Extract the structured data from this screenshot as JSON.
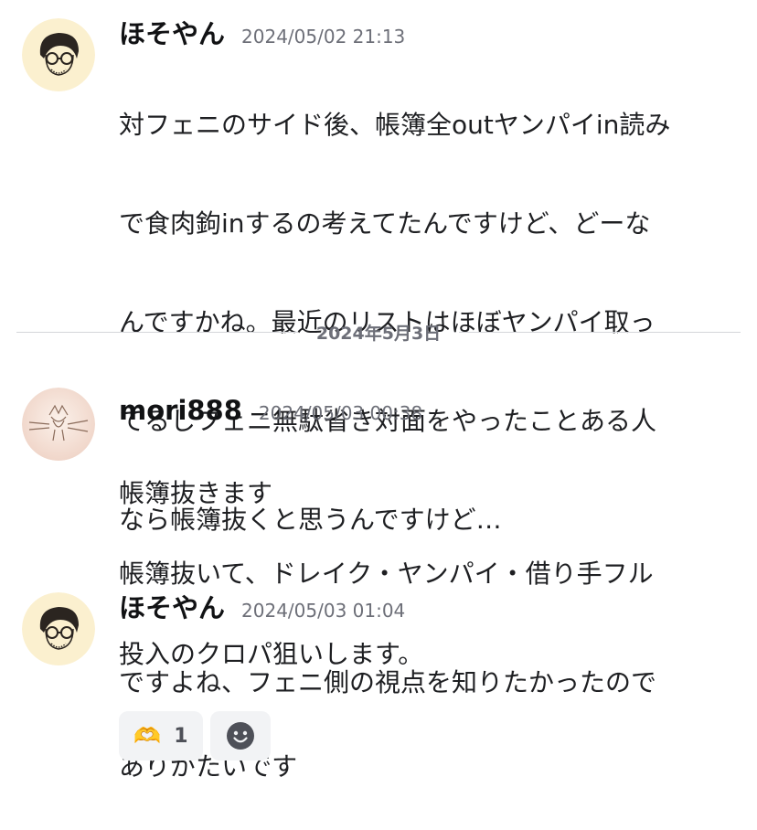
{
  "messages": [
    {
      "username": "ほそやん",
      "timestamp": "2024/05/02 21:13",
      "lines": [
        "対フェニのサイド後、帳簿全outヤンパイin読み",
        "で食肉鉤inするの考えてたんですけど、どーな",
        "んですかね。最近のリストはほぼヤンパイ取っ",
        "てるしフェニ無駄省き対面をやったことある人",
        "なら帳簿抜くと思うんですけど…"
      ]
    },
    {
      "username": "mori888",
      "timestamp": "2024/05/03 00:38",
      "lines": [
        "帳簿抜きます",
        "帳簿抜いて、ドレイク・ヤンパイ・借り手フル",
        "投入のクロパ狙いします。"
      ]
    },
    {
      "username": "ほそやん",
      "timestamp": "2024/05/03 01:04",
      "lines": [
        "ですよね、フェニ側の視点を知りたかったので",
        "ありがたいです"
      ]
    }
  ],
  "date_divider": "2024年5月3日",
  "reactions": {
    "heart_hands": {
      "emoji": "🫶",
      "count": "1"
    },
    "add_reaction_icon": "smiley-add-icon"
  },
  "colors": {
    "username": "#111214",
    "timestamp": "#6d6f78",
    "body_text": "#1e1f22",
    "divider_line": "#d4d6da",
    "reaction_bg": "#f2f3f5",
    "avatar_hosoyan_bg": "#fbf0cf",
    "avatar_mori_bg": "#f7e4dc"
  }
}
